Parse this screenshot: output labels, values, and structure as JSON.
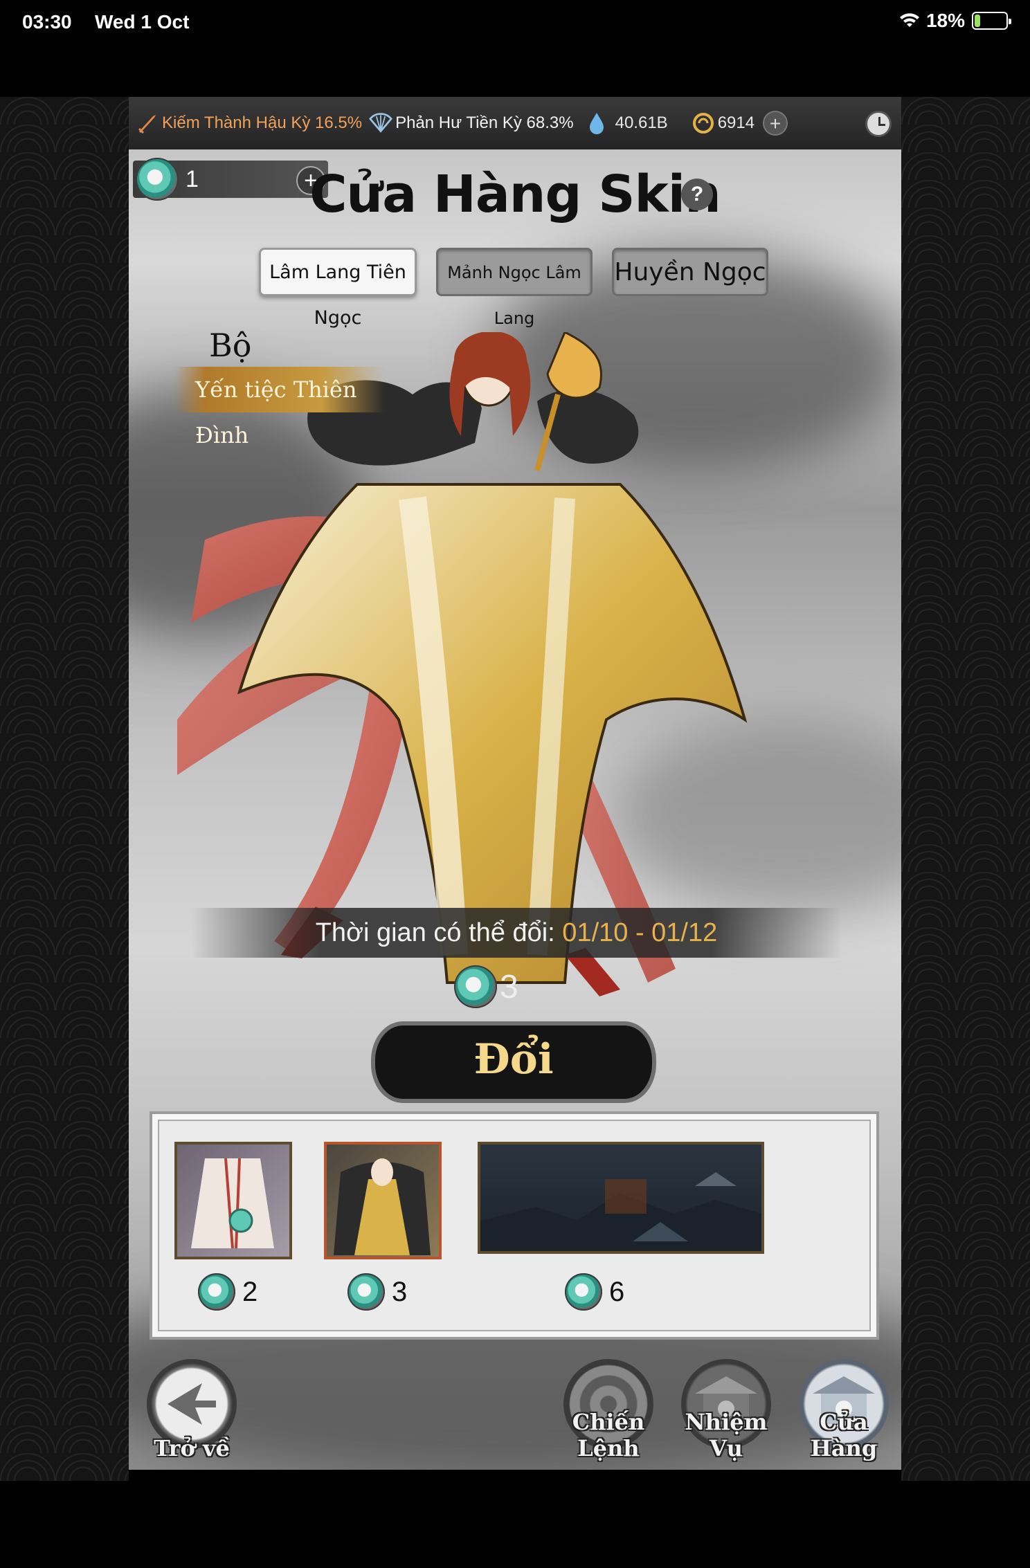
{
  "status_bar": {
    "time": "03:30",
    "date": "Wed 1 Oct",
    "battery": "18%",
    "battery_level": 0.18
  },
  "topbar": {
    "realm_1": "Kiếm Thành Hậu Kỳ 16.5%",
    "realm_2": "Phản Hư Tiền Kỳ 68.3%",
    "resource_1": "40.61B",
    "resource_2": "6914",
    "plus": "+",
    "icons": [
      "sword-icon",
      "fan-icon",
      "water-drop-icon",
      "coin-icon",
      "clock-icon"
    ]
  },
  "token": {
    "count": "1",
    "plus": "+"
  },
  "title": "Cửa Hàng Skin",
  "help": "?",
  "tabs": [
    {
      "label": "Lâm Lang Tiên Ngọc",
      "active": true
    },
    {
      "label": "Mảnh Ngọc Lâm Lang",
      "active": false
    },
    {
      "label": "Huyền Ngọc",
      "active": false
    }
  ],
  "set": {
    "label": "Bộ",
    "name": "Yến tiệc Thiên Đình"
  },
  "exchange_time": {
    "label": "Thời gian có thể đổi:",
    "range": "01/10 - 01/12"
  },
  "main_cost": "3",
  "exchange_button": "Đổi",
  "items": [
    {
      "cost": "2"
    },
    {
      "cost": "3"
    },
    {
      "cost": "6"
    }
  ],
  "nav": {
    "back": "Trở về",
    "battle_pass": "Chiến Lệnh",
    "quests": "Nhiệm Vụ",
    "shop": "Cửa Hàng"
  },
  "colors": {
    "realm_1": "#f0a25c",
    "time_range": "#e7b24c",
    "exchange_text": "#f6d88a",
    "set_banner": "#c89a40"
  }
}
